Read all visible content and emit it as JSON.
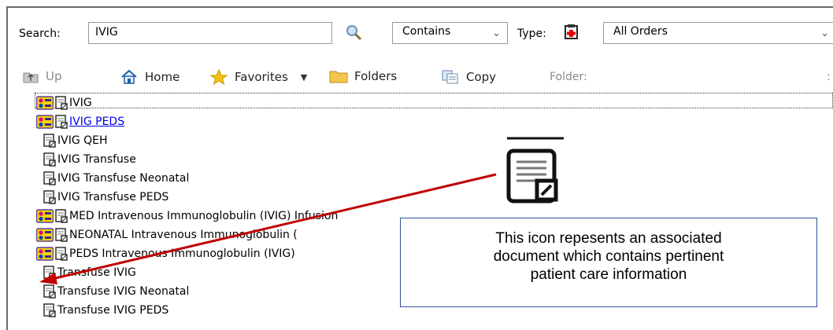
{
  "search": {
    "label": "Search:",
    "value": "IVIG",
    "mode": "Contains"
  },
  "type": {
    "label": "Type:",
    "value": "All Orders"
  },
  "toolbar": {
    "up": "Up",
    "home": "Home",
    "favorites": "Favorites",
    "folders": "Folders",
    "copy": "Copy",
    "folder_label": "Folder:"
  },
  "results": [
    {
      "label": "IVIG",
      "has_careset_icon": true,
      "style": "selected"
    },
    {
      "label": "IVIG PEDS",
      "has_careset_icon": true,
      "style": "link"
    },
    {
      "label": "IVIG QEH",
      "has_careset_icon": false,
      "style": "normal"
    },
    {
      "label": "IVIG Transfuse",
      "has_careset_icon": false,
      "style": "normal"
    },
    {
      "label": "IVIG Transfuse Neonatal",
      "has_careset_icon": false,
      "style": "normal"
    },
    {
      "label": "IVIG Transfuse PEDS",
      "has_careset_icon": false,
      "style": "normal"
    },
    {
      "label": "MED Intravenous Immunoglobulin (IVIG) Infusion",
      "has_careset_icon": true,
      "style": "normal"
    },
    {
      "label": "NEONATAL Intravenous Immunoglobulin (",
      "has_careset_icon": true,
      "style": "normal"
    },
    {
      "label": "PEDS Intravenous Immunoglobulin (IVIG)",
      "has_careset_icon": true,
      "style": "normal"
    },
    {
      "label": "Transfuse IVIG",
      "has_careset_icon": false,
      "style": "normal"
    },
    {
      "label": "Transfuse IVIG Neonatal",
      "has_careset_icon": false,
      "style": "normal"
    },
    {
      "label": "Transfuse IVIG PEDS",
      "has_careset_icon": false,
      "style": "normal"
    }
  ],
  "callout": {
    "lines": [
      "This icon repesents an associated",
      "document which contains pertinent",
      "patient care information"
    ],
    "border_color": "#2f5597"
  },
  "arrow_color": "#c00000",
  "icons": [
    "search-icon",
    "order-type-icon",
    "up-icon",
    "home-icon",
    "star-icon",
    "folder-icon",
    "copy-icon",
    "careset-icon",
    "document-icon"
  ]
}
